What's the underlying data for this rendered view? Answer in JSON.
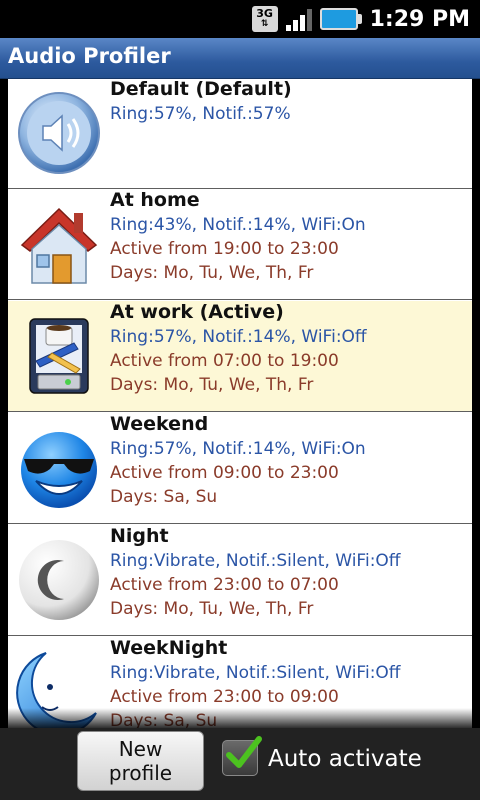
{
  "status_bar": {
    "network": "3G",
    "time": "1:29 PM"
  },
  "app": {
    "title": "Audio Profiler"
  },
  "profiles": [
    {
      "name": "Default (Default)",
      "settings": "Ring:57%, Notif.:57%",
      "active_from": "",
      "days": "",
      "icon": "speaker-icon"
    },
    {
      "name": "At home",
      "settings": "Ring:43%, Notif.:14%, WiFi:On",
      "active_from": "Active from 19:00 to 23:00",
      "days": "Days: Mo, Tu, We, Th, Fr",
      "icon": "house-icon"
    },
    {
      "name": "At work (Active)",
      "settings": "Ring:57%, Notif.:14%, WiFi:Off",
      "active_from": "Active from 07:00 to 19:00",
      "days": "Days: Mo, Tu, We, Th, Fr",
      "icon": "desk-icon",
      "active": true
    },
    {
      "name": "Weekend",
      "settings": "Ring:57%, Notif.:14%, WiFi:On",
      "active_from": "Active from 09:00 to 23:00",
      "days": "Days: Sa, Su",
      "icon": "sunglasses-smiley-icon"
    },
    {
      "name": "Night",
      "settings": "Ring:Vibrate, Notif.:Silent, WiFi:Off",
      "active_from": "Active from 23:00 to 07:00",
      "days": "Days: Mo, Tu, We, Th, Fr",
      "icon": "moon-button-icon"
    },
    {
      "name": "WeekNight",
      "settings": "Ring:Vibrate, Notif.:Silent, WiFi:Off",
      "active_from": "Active from 23:00 to 09:00",
      "days": "Days: Sa, Su",
      "icon": "crescent-moon-face-icon"
    }
  ],
  "bottom_bar": {
    "new_profile_label": "New profile",
    "auto_activate_label": "Auto activate",
    "auto_activate_checked": true
  },
  "colors": {
    "title_bar": "#2d5a9e",
    "settings_text": "#2b55a6",
    "schedule_text": "#8a3b2a",
    "active_row": "#fdf8d6",
    "check_green": "#4cc21f"
  }
}
